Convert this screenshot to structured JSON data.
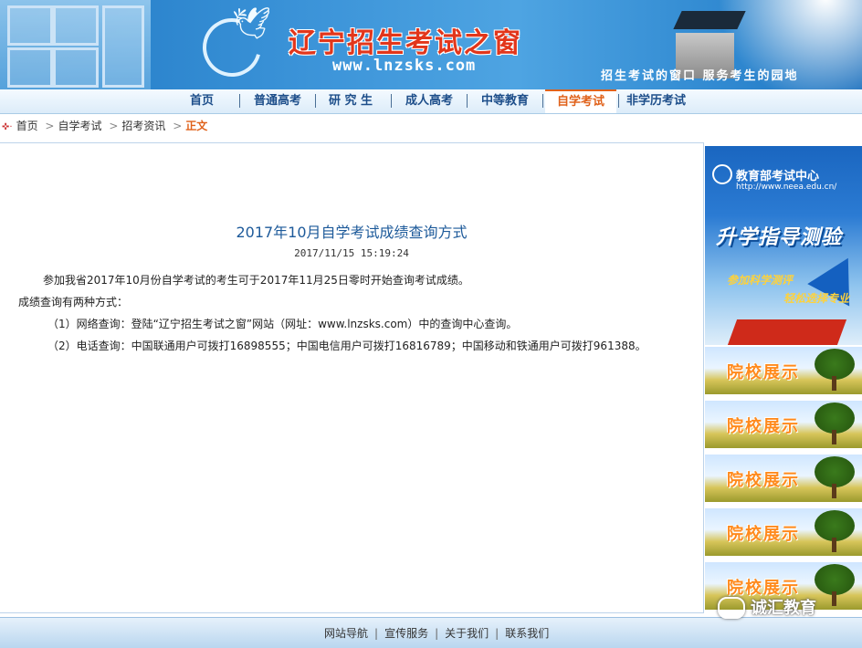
{
  "header": {
    "site_title": "辽宁招生考试之窗",
    "site_url": "www.lnzsks.com",
    "slogan": "招生考试的窗口  服务考生的园地"
  },
  "nav": {
    "items": [
      {
        "label": "首页"
      },
      {
        "label": "普通高考"
      },
      {
        "label": "研 究 生"
      },
      {
        "label": "成人高考"
      },
      {
        "label": "中等教育"
      },
      {
        "label": "自学考试",
        "active": true
      },
      {
        "label": "非学历考试"
      }
    ]
  },
  "breadcrumb": {
    "items": [
      "首页",
      "自学考试",
      "招考资讯"
    ],
    "current": "正文",
    "separator": ">"
  },
  "article": {
    "title": "2017年10月自学考试成绩查询方式",
    "time": "2017/11/15 15:19:24",
    "paragraphs": [
      "参加我省2017年10月份自学考试的考生可于2017年11月25日零时开始查询考试成绩。",
      "成绩查询有两种方式：",
      "（1）网络查询：登陆“辽宁招生考试之窗”网站（网址：www.lnzsks.com）中的查询中心查询。",
      "（2）电话查询：中国联通用户可拨打16898555；中国电信用户可拨打16816789；中国移动和铁通用户可拨打961388。"
    ]
  },
  "sidebar": {
    "neea": {
      "title": "教育部考试中心",
      "url": "http://www.neea.edu.cn/",
      "slogan": "升学指导测验",
      "sub1": "参加科学测评",
      "sub2": "轻松选择专业"
    },
    "school_label": "院校展示",
    "school_count": 5
  },
  "footer": {
    "links": [
      "网站导航",
      "宣传服务",
      "关于我们",
      "联系我们"
    ],
    "separator": "|"
  },
  "watermark": "诚汇教育",
  "colors": {
    "accent": "#e0621b",
    "link": "#1d4e8a",
    "title": "#1d5a9a"
  }
}
